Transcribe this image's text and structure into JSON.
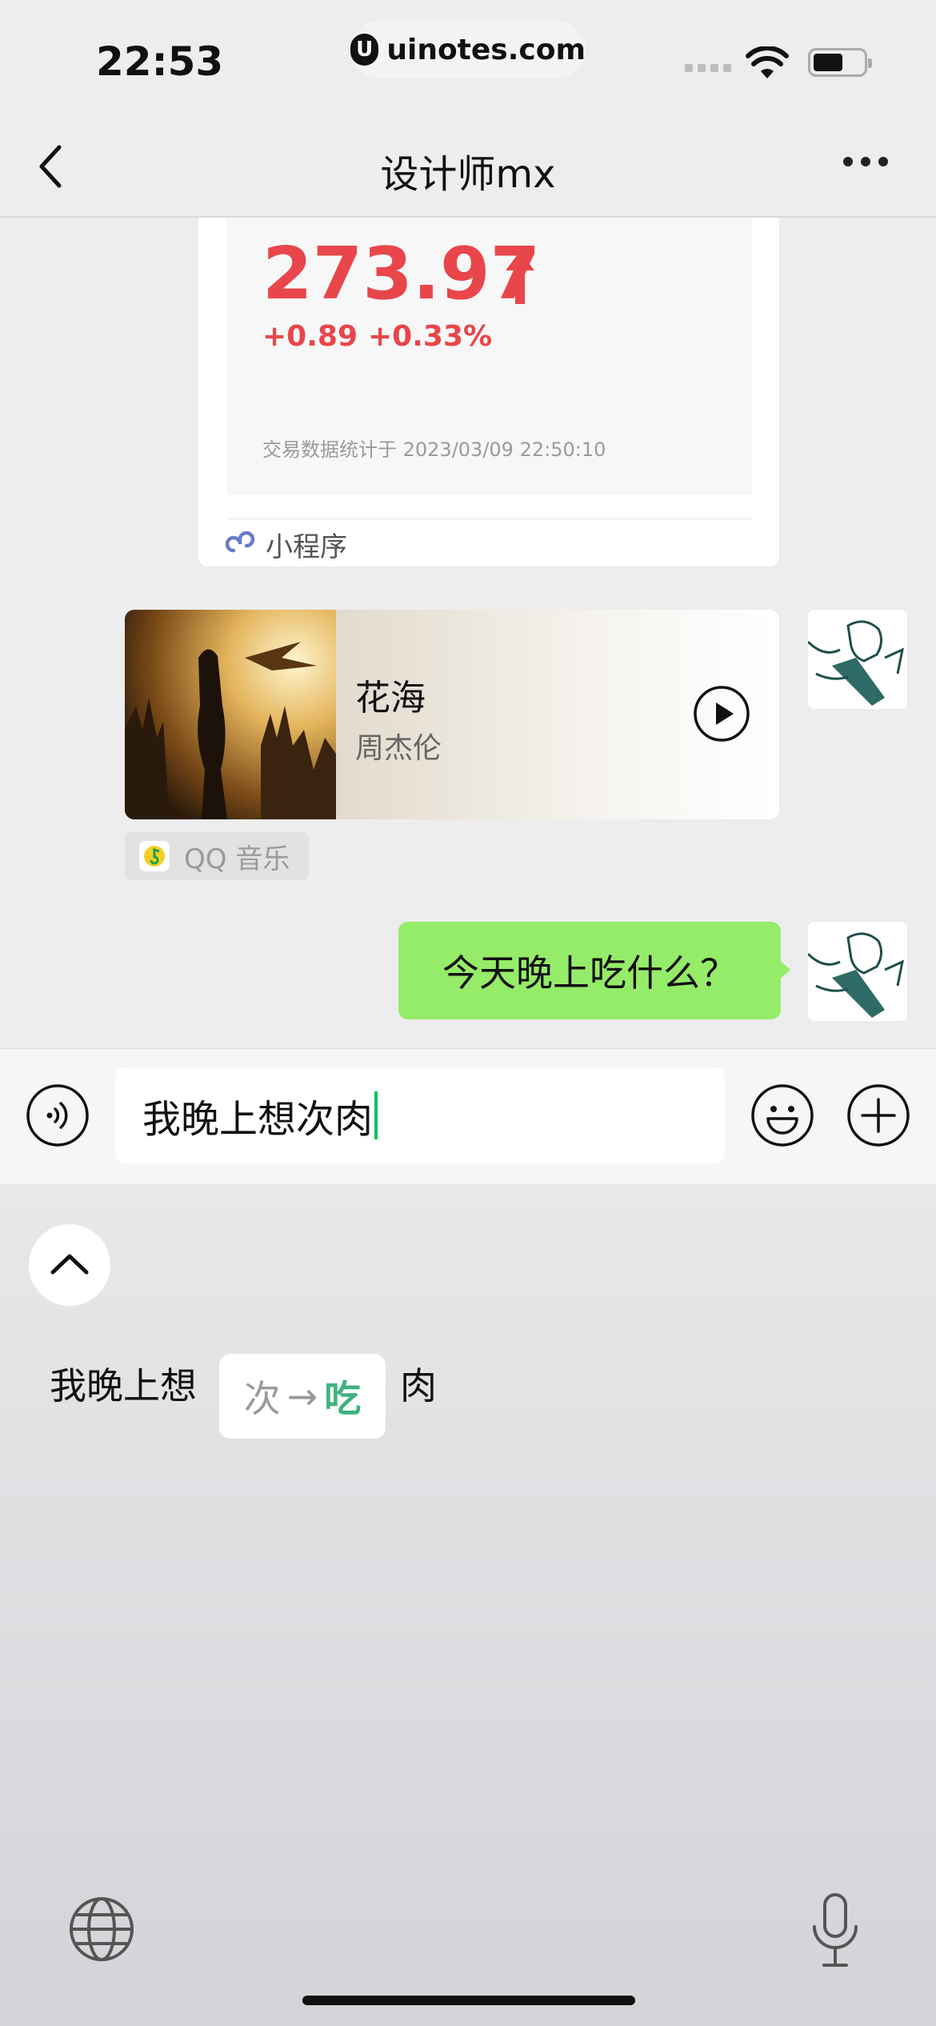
{
  "status_bar": {
    "time": "22:53",
    "url": "uinotes.com",
    "url_logo": "U"
  },
  "nav": {
    "title": "设计师mx"
  },
  "stock_card": {
    "price": "273.97",
    "change": "+0.89",
    "change_pct": "+0.33%",
    "note": "交易数据统计于 2023/03/09 22:50:10",
    "source_label": "小程序",
    "trend_color": "#e8464a"
  },
  "music_card": {
    "title": "花海",
    "artist": "周杰伦",
    "source_label": "QQ 音乐"
  },
  "messages": [
    {
      "text": "今天晚上吃什么？",
      "bubble_color": "#95ec69"
    }
  ],
  "input": {
    "value": "我晚上想次肉"
  },
  "correction": {
    "prefix": "我晚上想",
    "wrong": "次",
    "arrow": "→",
    "right": "吃",
    "suffix": "肉",
    "highlight_color": "#3fb37f"
  }
}
